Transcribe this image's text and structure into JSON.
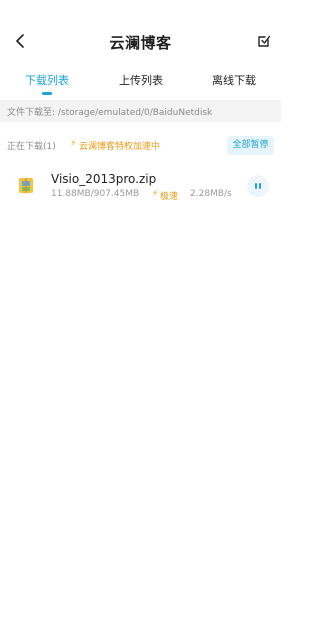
{
  "header": {
    "title": "云澜博客",
    "back_icon": "chevron-left-icon",
    "edit_icon": "edit-check-icon"
  },
  "tabs": [
    {
      "label": "下载列表",
      "active": true
    },
    {
      "label": "上传列表",
      "active": false
    },
    {
      "label": "离线下载",
      "active": false
    }
  ],
  "path_bar": {
    "text": "文件下载至: /storage/emulated/0/BaiduNetdisk"
  },
  "status": {
    "downloading_label": "正在下载(1)",
    "privilege_label": "云澜博客特权加速中",
    "pause_all_label": "全部暂停"
  },
  "downloads": [
    {
      "file_name": "Visio_2013pro.zip",
      "size_progress": "11.88MB/907.45MB",
      "speed_label": "极速",
      "speed_value": "2.28MB/s",
      "icon": "zip-file-icon"
    }
  ],
  "colors": {
    "accent": "#1aa3d8",
    "privilege": "#e79a10",
    "path_bg": "#f3f3f3"
  }
}
